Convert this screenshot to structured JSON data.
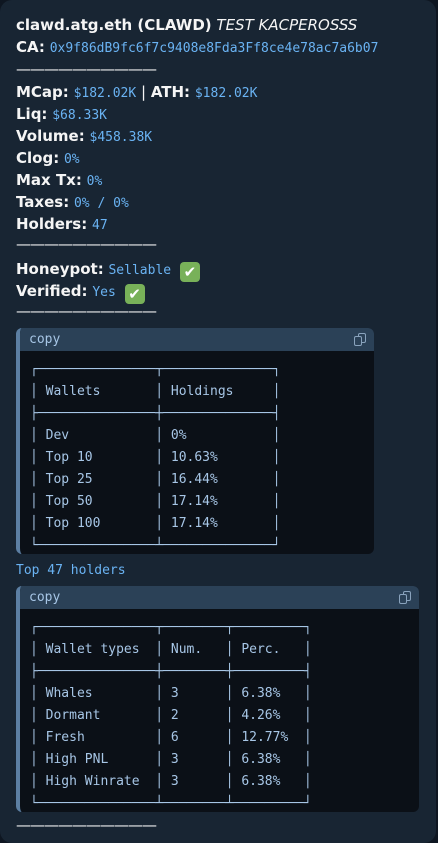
{
  "header": {
    "token_name": "clawd.atg.eth (CLAWD)",
    "tag": "TEST KACPEROSSS",
    "ca_label": "CA:",
    "ca_value": "0x9f86dB9fc6f7c9408e8Fda3Ff8ce4e78ac7a6b07"
  },
  "separator": "——————————",
  "stats": {
    "mcap_label": "MCap:",
    "mcap_value": "$182.02K",
    "pipe": "|",
    "ath_label": "ATH:",
    "ath_value": "$182.02K",
    "liq_label": "Liq:",
    "liq_value": "$68.33K",
    "volume_label": "Volume:",
    "volume_value": "$458.38K",
    "clog_label": "Clog:",
    "clog_value": "0%",
    "maxtx_label": "Max Tx:",
    "maxtx_value": "0%",
    "taxes_label": "Taxes:",
    "taxes_value": "0% / 0%",
    "holders_label": "Holders:",
    "holders_value": "47"
  },
  "checks": {
    "honeypot_label": "Honeypot:",
    "honeypot_value": "Sellable",
    "verified_label": "Verified:",
    "verified_value": "Yes",
    "check_mark": "✔"
  },
  "holdings_block": {
    "copy_label": "copy",
    "rows": [
      "┌───────────────┬──────────────┐",
      "│ Wallets       │ Holdings     │",
      "├───────────────┼──────────────┤",
      "│ Dev           │ 0%           │",
      "│ Top 10        │ 10.63%       │",
      "│ Top 25        │ 16.44%       │",
      "│ Top 50        │ 17.14%       │",
      "│ Top 100       │ 17.14%       │",
      "└───────────────┴──────────────┘"
    ]
  },
  "top_holders_link": "Top 47 holders",
  "wallets_block": {
    "copy_label": "copy",
    "rows": [
      "┌───────────────┬────────┬─────────┐",
      "│ Wallet types  │ Num.   │ Perc.   │",
      "├───────────────┼────────┼─────────┤",
      "│ Whales        │ 3      │ 6.38%   │",
      "│ Dormant       │ 2      │ 4.26%   │",
      "│ Fresh         │ 6      │ 12.77%  │",
      "│ High PNL      │ 3      │ 6.38%   │",
      "│ High Winrate  │ 3      │ 6.38%   │",
      "└───────────────┴────────┴─────────┘"
    ]
  }
}
